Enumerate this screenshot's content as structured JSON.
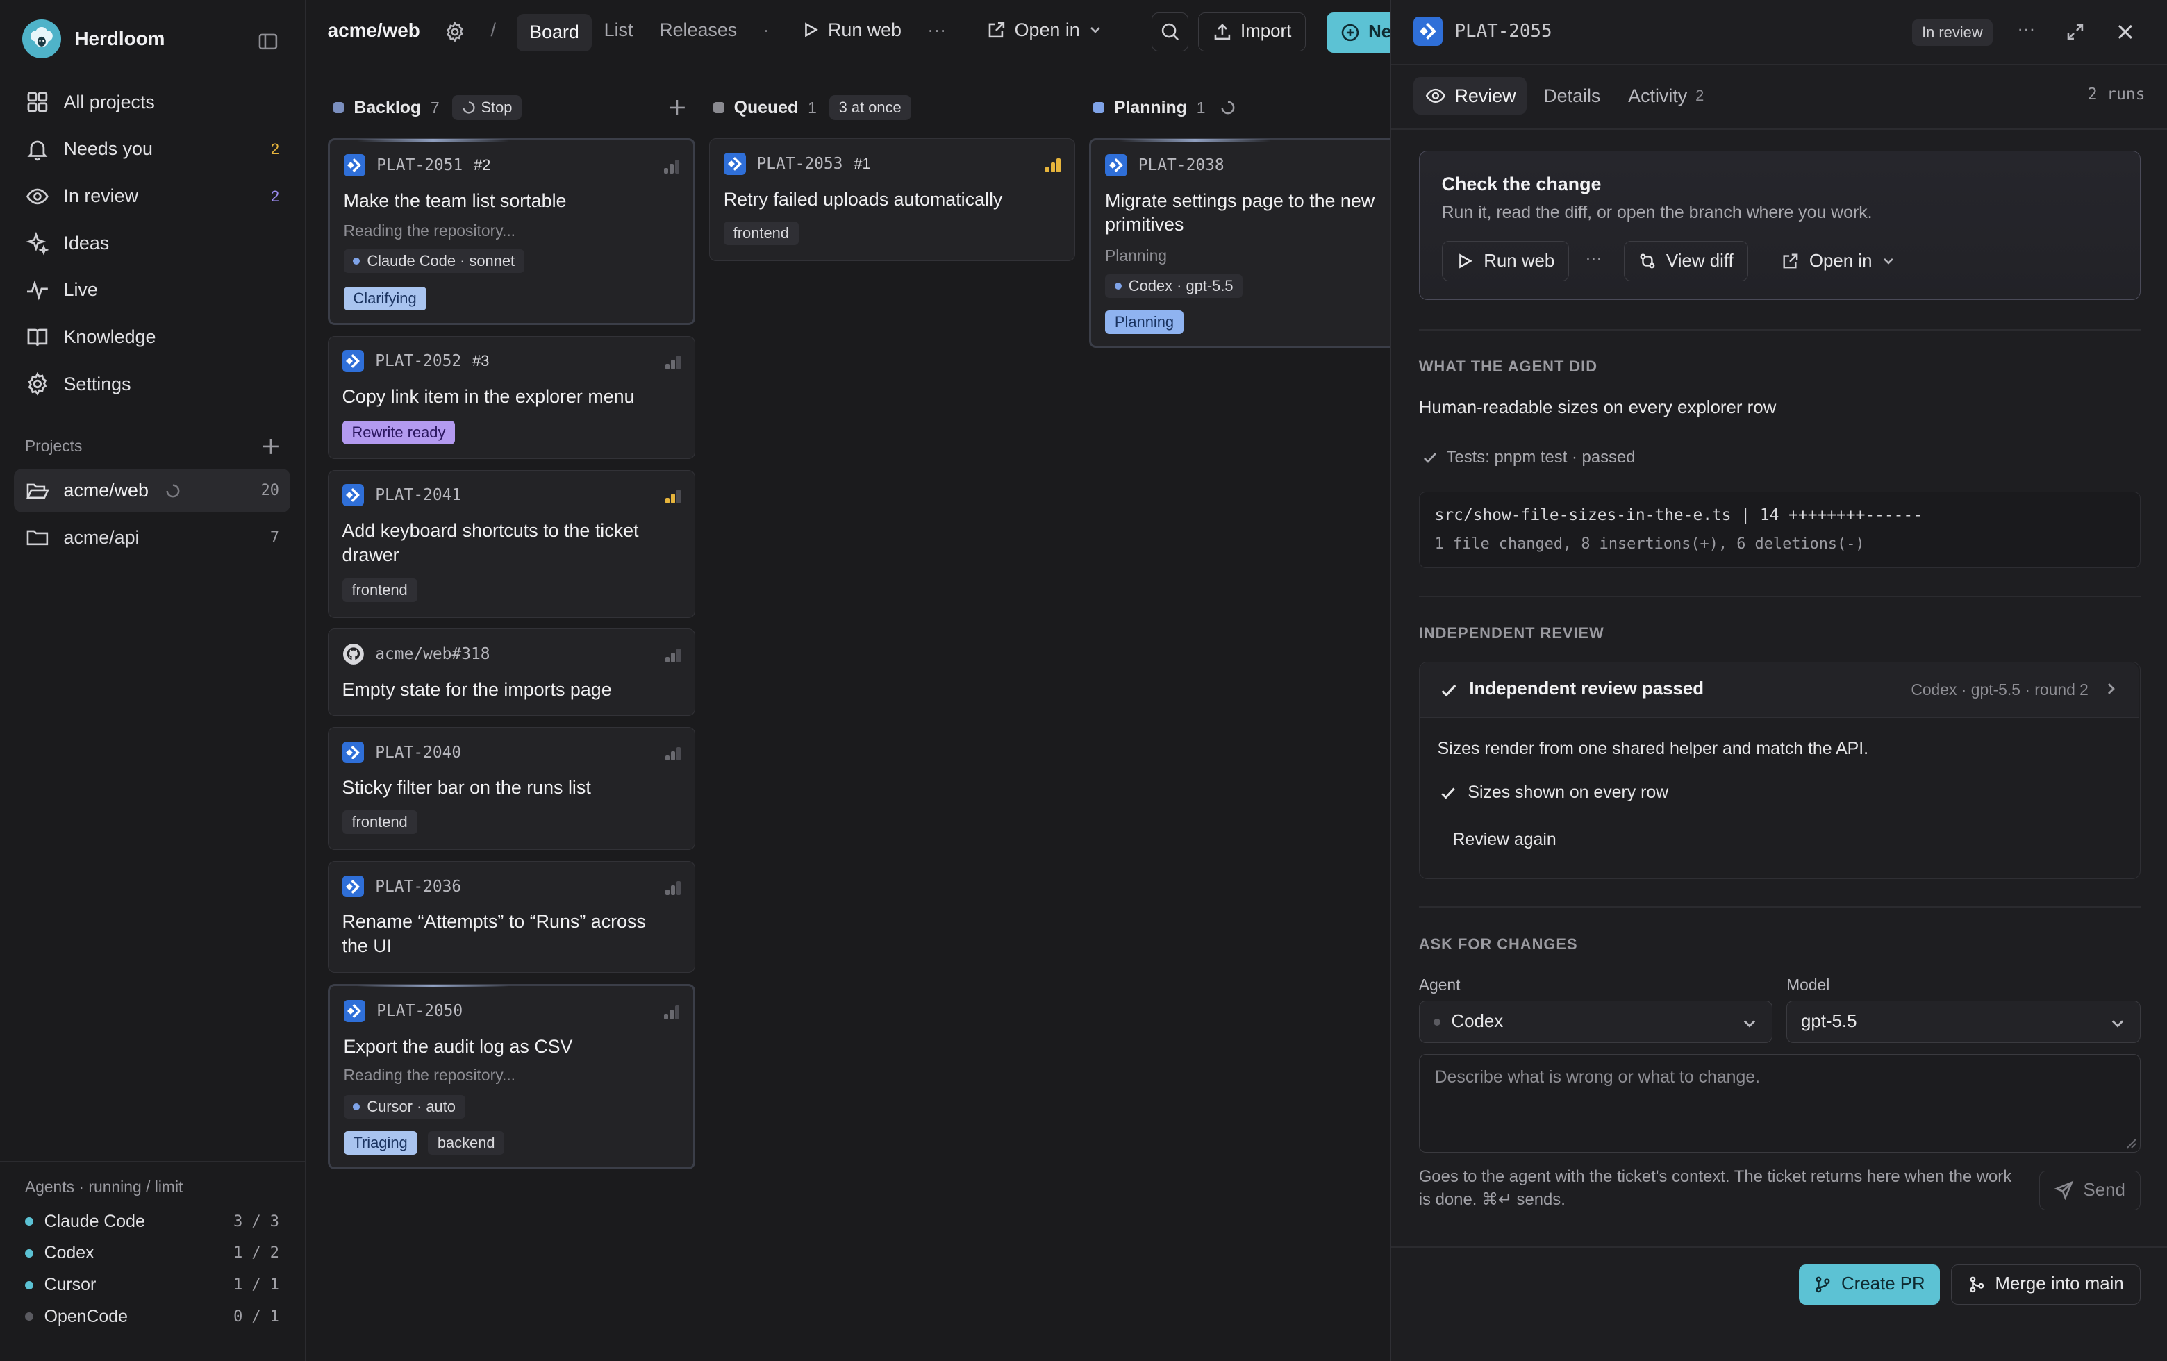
{
  "app": {
    "name": "Herdloom"
  },
  "sidebar": {
    "nav": [
      {
        "label": "All projects",
        "icon": "grid-icon"
      },
      {
        "label": "Needs you",
        "icon": "bell-icon",
        "count": "2"
      },
      {
        "label": "In review",
        "icon": "eye-icon",
        "count": "2"
      },
      {
        "label": "Ideas",
        "icon": "sparkle-icon"
      },
      {
        "label": "Live",
        "icon": "activity-icon"
      },
      {
        "label": "Knowledge",
        "icon": "book-icon"
      },
      {
        "label": "Settings",
        "icon": "gear-icon"
      }
    ],
    "projects_label": "Projects",
    "projects": [
      {
        "name": "acme/web",
        "count": "20"
      },
      {
        "name": "acme/api",
        "count": "7"
      }
    ],
    "agents_header": "Agents · running / limit",
    "agents": [
      {
        "name": "Claude Code",
        "limit": "3 / 3",
        "color": "#5cc2d4"
      },
      {
        "name": "Codex",
        "limit": "1 / 2",
        "color": "#5cc2d4"
      },
      {
        "name": "Cursor",
        "limit": "1 / 1",
        "color": "#5cc2d4"
      },
      {
        "name": "OpenCode",
        "limit": "0 / 1",
        "color": "#5a5a60"
      }
    ]
  },
  "topbar": {
    "project": "acme/web",
    "separator": "/",
    "tabs": [
      "Board",
      "List",
      "Releases"
    ],
    "dot": "·",
    "run_label": "Run web",
    "more": "···",
    "open_in": "Open in",
    "import": "Import",
    "new": "New"
  },
  "columns": {
    "backlog": {
      "name": "Backlog",
      "count": "7",
      "action": "Stop"
    },
    "queued": {
      "name": "Queued",
      "count": "1",
      "badge": "3 at once"
    },
    "planning": {
      "name": "Planning",
      "count": "1"
    }
  },
  "cards": {
    "c2051": {
      "id": "PLAT-2051",
      "num": "#2",
      "title": "Make the team list sortable",
      "sub": "Reading the repository...",
      "agent": "Claude Code · sonnet",
      "tag": "Clarifying"
    },
    "c2052": {
      "id": "PLAT-2052",
      "num": "#3",
      "title": "Copy link item in the explorer menu",
      "tag": "Rewrite ready"
    },
    "c2041": {
      "id": "PLAT-2041",
      "title": "Add keyboard shortcuts to the ticket drawer",
      "tag": "frontend"
    },
    "gh318": {
      "id": "acme/web#318",
      "title": "Empty state for the imports page"
    },
    "c2040": {
      "id": "PLAT-2040",
      "title": "Sticky filter bar on the runs list",
      "tag": "frontend"
    },
    "c2036": {
      "id": "PLAT-2036",
      "title": "Rename “Attempts” to “Runs” across the UI"
    },
    "c2050": {
      "id": "PLAT-2050",
      "title": "Export the audit log as CSV",
      "sub": "Reading the repository...",
      "agent": "Cursor · auto",
      "tag": "Triaging",
      "tag2": "backend"
    },
    "c2053": {
      "id": "PLAT-2053",
      "num": "#1",
      "title": "Retry failed uploads automatically",
      "tag": "frontend"
    },
    "c2038": {
      "id": "PLAT-2038",
      "title": "Migrate settings page to the new primitives",
      "sub": "Planning",
      "agent": "Codex · gpt-5.5",
      "tag": "Planning"
    }
  },
  "panel": {
    "ticket_id": "PLAT-2055",
    "status": "In review",
    "more": "···",
    "tabs": [
      {
        "label": "Review"
      },
      {
        "label": "Details"
      },
      {
        "label": "Activity",
        "count": "2"
      }
    ],
    "runs": "2 runs",
    "check": {
      "title": "Check the change",
      "subtitle": "Run it, read the diff, or open the branch where you work.",
      "run": "Run web",
      "more": "···",
      "view_diff": "View diff",
      "open_in": "Open in"
    },
    "agent_did": {
      "heading": "WHAT THE AGENT DID",
      "summary": "Human-readable sizes on every explorer row",
      "tests": "Tests: pnpm test · passed",
      "diff_line1": "src/show-file-sizes-in-the-e.ts | 14 ++++++++------",
      "diff_line2": "1 file changed, 8 insertions(+), 6 deletions(-)"
    },
    "review": {
      "heading": "INDEPENDENT REVIEW",
      "title": "Independent review passed",
      "meta": "Codex · gpt-5.5 · round 2",
      "body": "Sizes render from one shared helper and match the API.",
      "check_item": "Sizes shown on every row",
      "again": "Review again"
    },
    "ask": {
      "heading": "ASK FOR CHANGES",
      "agent_label": "Agent",
      "agent_value": "Codex",
      "model_label": "Model",
      "model_value": "gpt-5.5",
      "placeholder": "Describe what is wrong or what to change.",
      "note": "Goes to the agent with the ticket's context. The ticket returns here when the work is done. ⌘↵ sends.",
      "send": "Send"
    },
    "create_pr": "Create PR",
    "merge": "Merge into main"
  }
}
